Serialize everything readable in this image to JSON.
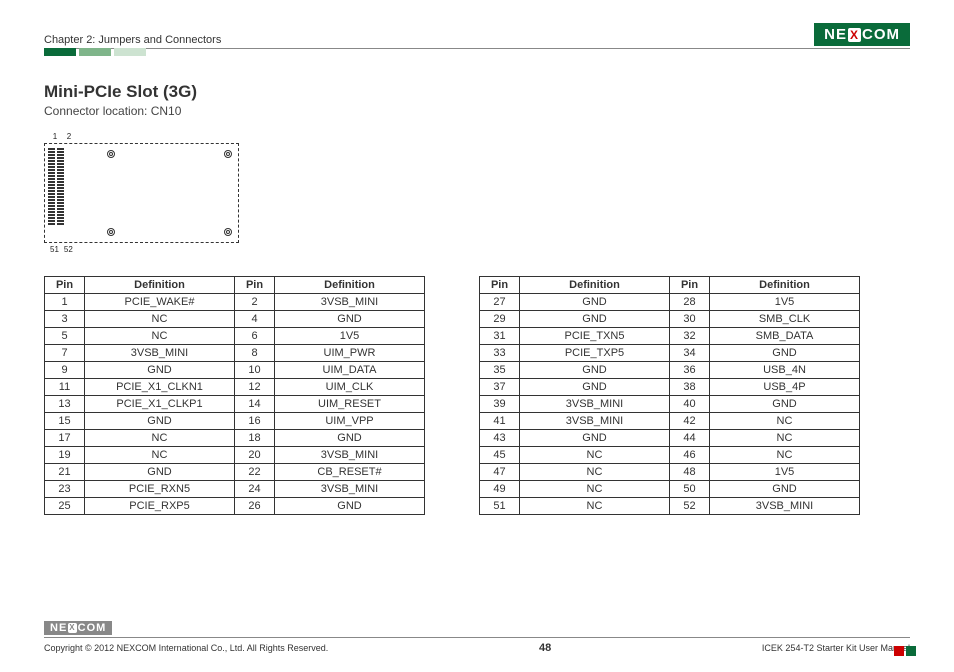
{
  "header": {
    "chapter": "Chapter 2: Jumpers and Connectors",
    "brand_left": "NE",
    "brand_x": "X",
    "brand_right": "COM"
  },
  "section": {
    "title": "Mini-PCIe Slot (3G)",
    "subtitle": "Connector location: CN10"
  },
  "diagram": {
    "top_left_pin": "1",
    "top_right_pin": "2",
    "bot_left_pin": "51",
    "bot_right_pin": "52"
  },
  "table_headers": {
    "pin": "Pin",
    "def": "Definition"
  },
  "table_left": [
    {
      "p1": "1",
      "d1": "PCIE_WAKE#",
      "p2": "2",
      "d2": "3VSB_MINI"
    },
    {
      "p1": "3",
      "d1": "NC",
      "p2": "4",
      "d2": "GND"
    },
    {
      "p1": "5",
      "d1": "NC",
      "p2": "6",
      "d2": "1V5"
    },
    {
      "p1": "7",
      "d1": "3VSB_MINI",
      "p2": "8",
      "d2": "UIM_PWR"
    },
    {
      "p1": "9",
      "d1": "GND",
      "p2": "10",
      "d2": "UIM_DATA"
    },
    {
      "p1": "11",
      "d1": "PCIE_X1_CLKN1",
      "p2": "12",
      "d2": "UIM_CLK"
    },
    {
      "p1": "13",
      "d1": "PCIE_X1_CLKP1",
      "p2": "14",
      "d2": "UIM_RESET"
    },
    {
      "p1": "15",
      "d1": "GND",
      "p2": "16",
      "d2": "UIM_VPP"
    },
    {
      "p1": "17",
      "d1": "NC",
      "p2": "18",
      "d2": "GND"
    },
    {
      "p1": "19",
      "d1": "NC",
      "p2": "20",
      "d2": "3VSB_MINI"
    },
    {
      "p1": "21",
      "d1": "GND",
      "p2": "22",
      "d2": "CB_RESET#"
    },
    {
      "p1": "23",
      "d1": "PCIE_RXN5",
      "p2": "24",
      "d2": "3VSB_MINI"
    },
    {
      "p1": "25",
      "d1": "PCIE_RXP5",
      "p2": "26",
      "d2": "GND"
    }
  ],
  "table_right": [
    {
      "p1": "27",
      "d1": "GND",
      "p2": "28",
      "d2": "1V5"
    },
    {
      "p1": "29",
      "d1": "GND",
      "p2": "30",
      "d2": "SMB_CLK"
    },
    {
      "p1": "31",
      "d1": "PCIE_TXN5",
      "p2": "32",
      "d2": "SMB_DATA"
    },
    {
      "p1": "33",
      "d1": "PCIE_TXP5",
      "p2": "34",
      "d2": "GND"
    },
    {
      "p1": "35",
      "d1": "GND",
      "p2": "36",
      "d2": "USB_4N"
    },
    {
      "p1": "37",
      "d1": "GND",
      "p2": "38",
      "d2": "USB_4P"
    },
    {
      "p1": "39",
      "d1": "3VSB_MINI",
      "p2": "40",
      "d2": "GND"
    },
    {
      "p1": "41",
      "d1": "3VSB_MINI",
      "p2": "42",
      "d2": "NC"
    },
    {
      "p1": "43",
      "d1": "GND",
      "p2": "44",
      "d2": "NC"
    },
    {
      "p1": "45",
      "d1": "NC",
      "p2": "46",
      "d2": "NC"
    },
    {
      "p1": "47",
      "d1": "NC",
      "p2": "48",
      "d2": "1V5"
    },
    {
      "p1": "49",
      "d1": "NC",
      "p2": "50",
      "d2": "GND"
    },
    {
      "p1": "51",
      "d1": "NC",
      "p2": "52",
      "d2": "3VSB_MINI"
    }
  ],
  "footer": {
    "copyright": "Copyright © 2012 NEXCOM International Co., Ltd. All Rights Reserved.",
    "page": "48",
    "manual": "ICEK 254-T2 Starter Kit User Manual"
  }
}
